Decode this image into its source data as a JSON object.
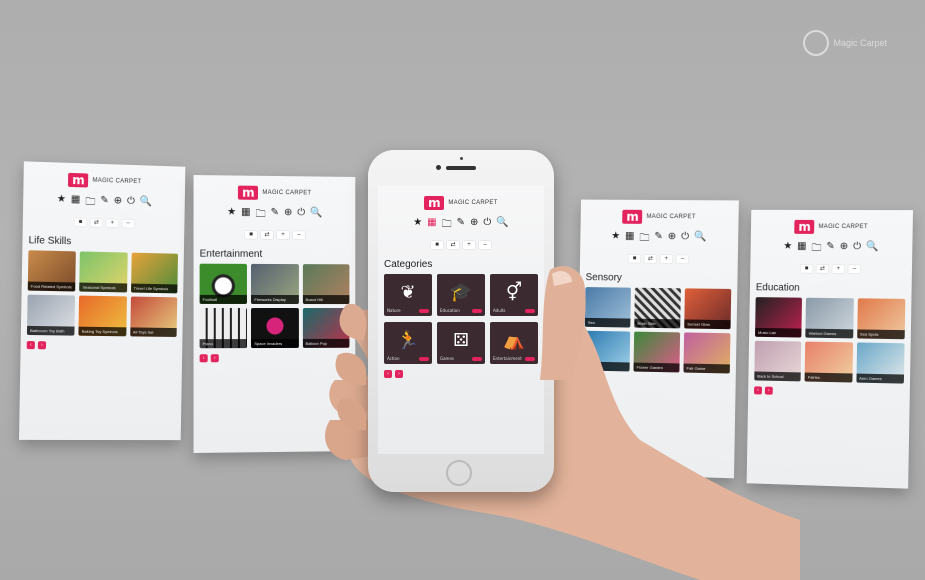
{
  "brand": {
    "name": "MAGIC CARPET",
    "logo_letter": "m",
    "accent": "#e2235d"
  },
  "toolbar_icons": [
    "★",
    "▦",
    "🗀",
    "✎",
    "⊕",
    "⏻",
    "🔍"
  ],
  "controls": [
    "■",
    "⇄",
    "+",
    "–"
  ],
  "pager": [
    "‹",
    "›"
  ],
  "cards": [
    {
      "title": "Life Skills",
      "tiles": [
        "Food Related Symbols",
        "Seasonal Symbols",
        "Travel Life Symbols",
        "Bathroom Toy Bath",
        "Baking Toy Symbols",
        "All Toys Set"
      ]
    },
    {
      "title": "Entertainment",
      "tiles": [
        "Football",
        "Fireworks Display",
        "Board Hill",
        "Piano",
        "Space Invaders",
        "Balloon Pop"
      ]
    },
    {
      "title": "Categories",
      "tiles": [
        "Nature",
        "Education",
        "Adults",
        "Action",
        "Games",
        "Entertainment"
      ]
    },
    {
      "title": "Sensory",
      "tiles": [
        "Sea",
        "Brain Skin",
        "Sunset Glow",
        "Flowers",
        "Flower Garden",
        "Fair Game"
      ]
    },
    {
      "title": "Education",
      "tiles": [
        "Music Lab",
        "Warlord Games",
        "Sea Spots",
        "Back to School",
        "Fairies",
        "Aero Games"
      ]
    }
  ],
  "watermark": "Magic Carpet"
}
